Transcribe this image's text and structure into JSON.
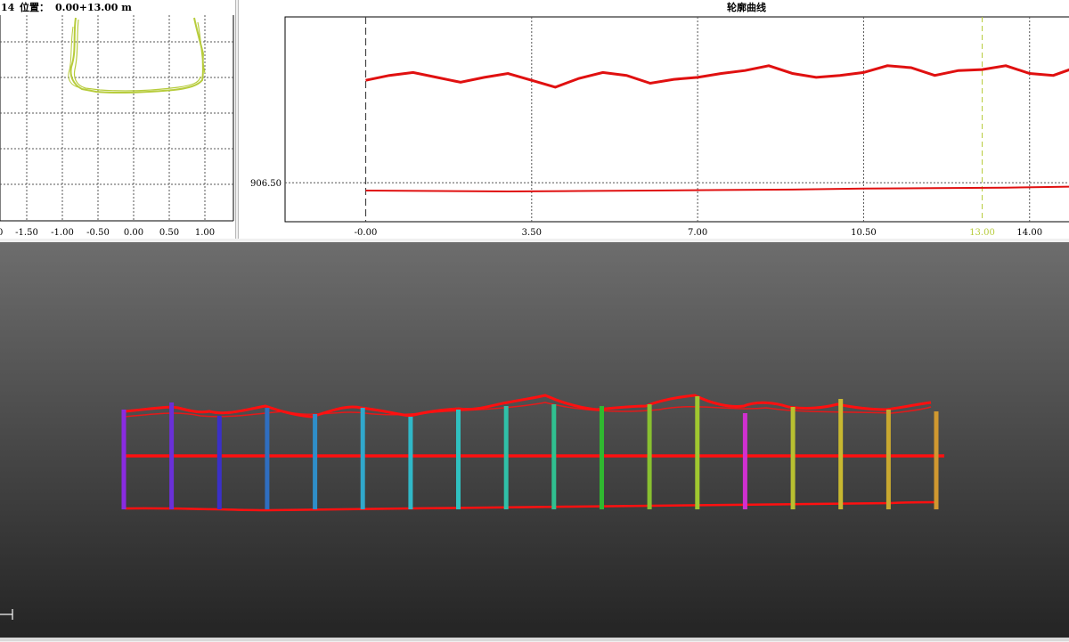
{
  "left_panel": {
    "header_index": "14",
    "header_label": "位置：",
    "header_position": "0.00+13.00 m",
    "plot_color": "#b7cc3c",
    "x_tick_labels": [
      "0",
      "-1.50",
      "-1.00",
      "-0.50",
      "0.00",
      "0.50",
      "1.00"
    ]
  },
  "profile_chart": {
    "title": "轮廓曲线",
    "curve_color": "#e01010",
    "cursor_color": "#b7cc3c",
    "y_tick_label": "906.50",
    "x_tick_labels": [
      "-0.00",
      "3.50",
      "7.00",
      "10.50",
      "13.00",
      "14.00"
    ],
    "highlighted_tick": "13.00"
  },
  "chart_data": {
    "type": "line",
    "title": "轮廓曲线",
    "xlabel": "",
    "ylabel": "",
    "xlim": [
      -1.7,
      14.85
    ],
    "x_ticks": [
      -0.0,
      3.5,
      7.0,
      10.5,
      13.0,
      14.0
    ],
    "y_ticks": [
      906.5
    ],
    "grid": true,
    "cursor_x": 13.0,
    "series": [
      {
        "x": [
          0.0,
          0.5,
          1.0,
          1.5,
          2.0,
          2.5,
          3.0,
          3.5,
          4.0,
          4.5,
          5.0,
          5.5,
          6.0,
          6.5,
          7.0,
          7.5,
          8.0,
          8.5,
          9.0,
          9.5,
          10.0,
          10.5,
          11.0,
          11.5,
          12.0,
          12.5,
          13.0,
          13.5,
          14.0,
          14.5,
          14.85
        ],
        "y": [
          907.55,
          907.6,
          907.63,
          907.58,
          907.53,
          907.58,
          907.62,
          907.55,
          907.48,
          907.57,
          907.63,
          907.6,
          907.52,
          907.56,
          907.58,
          907.62,
          907.65,
          907.7,
          907.62,
          907.58,
          907.6,
          907.63,
          907.7,
          907.68,
          907.6,
          907.65,
          907.66,
          907.7,
          907.62,
          907.6,
          907.66
        ]
      },
      {
        "x": [
          0.0,
          1.5,
          3.0,
          4.5,
          6.0,
          7.5,
          9.0,
          10.5,
          12.0,
          13.5,
          14.85
        ],
        "y": [
          906.42,
          906.415,
          906.41,
          906.415,
          906.42,
          906.425,
          906.43,
          906.44,
          906.445,
          906.45,
          906.46
        ]
      }
    ]
  },
  "viewport": {
    "background_top": "#6d6d6d",
    "background_bottom": "#242424",
    "profile_line_color": "#ff1010",
    "section_colors": [
      "#8a2be2",
      "#6a30d8",
      "#3a30c8",
      "#2f6ec0",
      "#2f8ec8",
      "#30a8cc",
      "#30b8c8",
      "#30c0c0",
      "#30c0a8",
      "#30c090",
      "#30b830",
      "#88c030",
      "#a0c830",
      "#d030d0",
      "#b8c030",
      "#c8b830",
      "#c8a830",
      "#d09830"
    ]
  }
}
